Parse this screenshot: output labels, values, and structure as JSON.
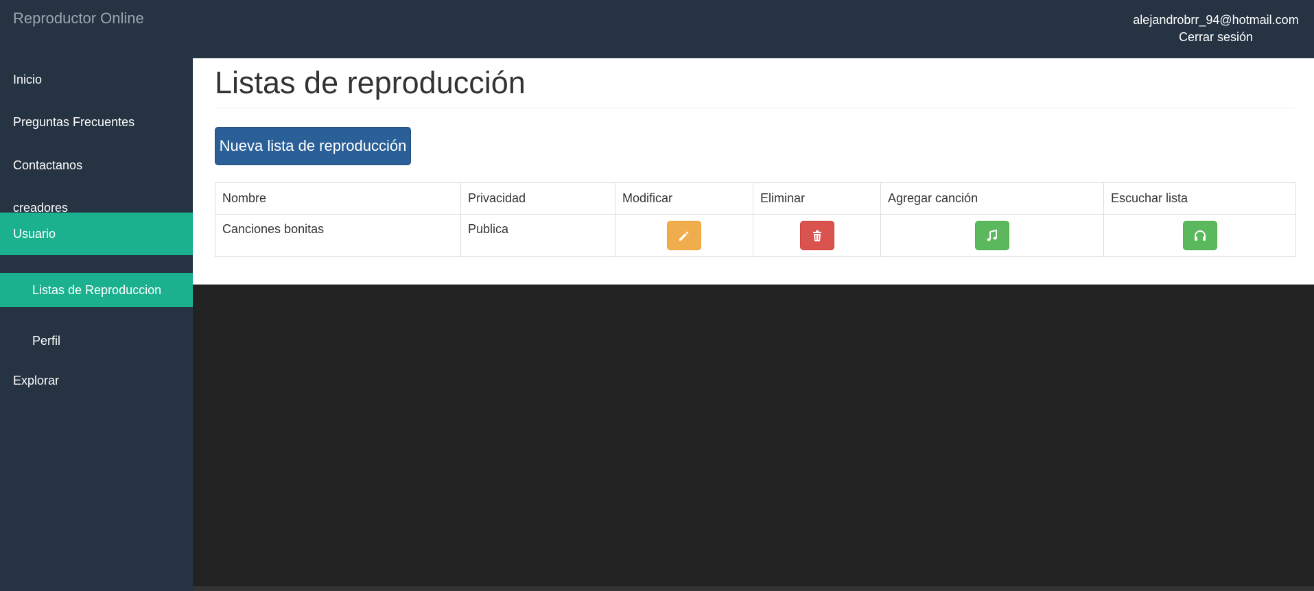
{
  "header": {
    "brand": "Reproductor Online",
    "user_email": "alejandrobrr_94@hotmail.com",
    "logout_label": "Cerrar sesión"
  },
  "sidebar": {
    "items": [
      {
        "label": "Inicio"
      },
      {
        "label": "Preguntas Frecuentes"
      },
      {
        "label": "Contactanos"
      },
      {
        "label": "creadores"
      },
      {
        "label": "Usuario",
        "active": true
      },
      {
        "label": "Explorar"
      }
    ],
    "sub_items": [
      {
        "label": "Listas de Reproduccion",
        "active": true
      },
      {
        "label": "Perfil"
      }
    ]
  },
  "main": {
    "title": "Listas de reproducción",
    "new_button_label": "Nueva lista de reproducción",
    "table": {
      "headers": [
        "Nombre",
        "Privacidad",
        "Modificar",
        "Eliminar",
        "Agregar canción",
        "Escuchar lista"
      ],
      "rows": [
        {
          "name": "Canciones bonitas",
          "privacy": "Publica",
          "actions": [
            "pencil-icon",
            "trash-icon",
            "music-note-icon",
            "headphones-icon"
          ]
        }
      ]
    }
  },
  "colors": {
    "navbar": "#253342",
    "active": "#1bb08e",
    "primary": "#2a6097",
    "warning": "#f0ad4e",
    "danger": "#d9534f",
    "success": "#5cb85c",
    "page_bg": "#222222"
  }
}
